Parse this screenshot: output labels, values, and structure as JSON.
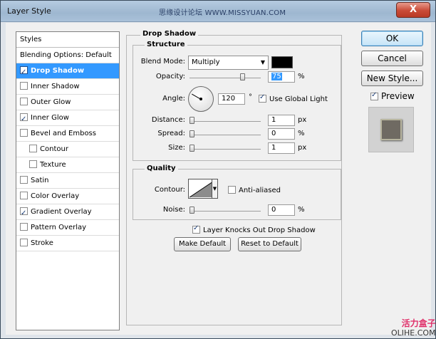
{
  "window": {
    "title": "Layer Style",
    "watermark": "思缘设计论坛 WWW.MISSYUAN.COM",
    "close_label": "X"
  },
  "styles_list": {
    "header": "Styles",
    "items": [
      {
        "label": "Blending Options: Default",
        "checkbox": false,
        "checked": false,
        "selected": false,
        "sub": false
      },
      {
        "label": "Drop Shadow",
        "checkbox": true,
        "checked": true,
        "selected": true,
        "sub": false
      },
      {
        "label": "Inner Shadow",
        "checkbox": true,
        "checked": false,
        "selected": false,
        "sub": false
      },
      {
        "label": "Outer Glow",
        "checkbox": true,
        "checked": false,
        "selected": false,
        "sub": false
      },
      {
        "label": "Inner Glow",
        "checkbox": true,
        "checked": true,
        "selected": false,
        "sub": false
      },
      {
        "label": "Bevel and Emboss",
        "checkbox": true,
        "checked": false,
        "selected": false,
        "sub": false
      },
      {
        "label": "Contour",
        "checkbox": true,
        "checked": false,
        "selected": false,
        "sub": true
      },
      {
        "label": "Texture",
        "checkbox": true,
        "checked": false,
        "selected": false,
        "sub": true
      },
      {
        "label": "Satin",
        "checkbox": true,
        "checked": false,
        "selected": false,
        "sub": false
      },
      {
        "label": "Color Overlay",
        "checkbox": true,
        "checked": false,
        "selected": false,
        "sub": false
      },
      {
        "label": "Gradient Overlay",
        "checkbox": true,
        "checked": true,
        "selected": false,
        "sub": false
      },
      {
        "label": "Pattern Overlay",
        "checkbox": true,
        "checked": false,
        "selected": false,
        "sub": false
      },
      {
        "label": "Stroke",
        "checkbox": true,
        "checked": false,
        "selected": false,
        "sub": false
      }
    ]
  },
  "drop_shadow": {
    "group_title": "Drop Shadow",
    "structure": {
      "title": "Structure",
      "blend_mode_label": "Blend Mode:",
      "blend_mode_value": "Multiply",
      "shadow_color": "#000000",
      "opacity_label": "Opacity:",
      "opacity_value": "75",
      "opacity_unit": "%",
      "opacity_level": 0.75,
      "angle_label": "Angle:",
      "angle_value": "120",
      "angle_unit": "°",
      "global_light_label": "Use Global Light",
      "global_light_checked": true,
      "distance_label": "Distance:",
      "distance_value": "1",
      "distance_unit": "px",
      "spread_label": "Spread:",
      "spread_value": "0",
      "spread_unit": "%",
      "size_label": "Size:",
      "size_value": "1",
      "size_unit": "px"
    },
    "quality": {
      "title": "Quality",
      "contour_label": "Contour:",
      "anti_aliased_label": "Anti-aliased",
      "anti_aliased_checked": false,
      "noise_label": "Noise:",
      "noise_value": "0",
      "noise_unit": "%"
    },
    "knockout_label": "Layer Knocks Out Drop Shadow",
    "knockout_checked": true,
    "make_default_label": "Make Default",
    "reset_default_label": "Reset to Default"
  },
  "buttons": {
    "ok": "OK",
    "cancel": "Cancel",
    "new_style": "New Style...",
    "preview_label": "Preview",
    "preview_checked": true
  },
  "watermark_bottom": {
    "line1": "活力盒子",
    "line2": "OLIHE.COM"
  }
}
